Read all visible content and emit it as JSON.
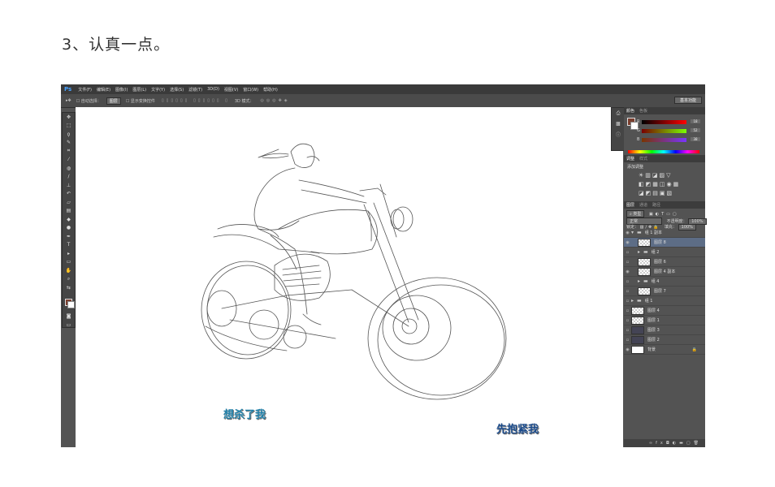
{
  "heading": "3、认真一点。",
  "app": {
    "logo": "Ps",
    "menu": [
      "文件(F)",
      "编辑(E)",
      "图像(I)",
      "图层(L)",
      "文字(Y)",
      "选择(S)",
      "滤镜(T)",
      "3D(D)",
      "视图(V)",
      "窗口(W)",
      "帮助(H)"
    ],
    "options": {
      "auto_select_label": "自动选择：",
      "auto_select_value": "图层",
      "show_transform": "显示变换控件",
      "mode_3d": "3D 模式：",
      "workspace": "基本功能"
    }
  },
  "canvas": {
    "caption1": "想杀了我",
    "caption2": "先抱紧我"
  },
  "panels": {
    "color_tabs": [
      "颜色",
      "色板"
    ],
    "color_sliders": [
      {
        "label": "R",
        "value": "18"
      },
      {
        "label": "G",
        "value": "52"
      },
      {
        "label": "B",
        "value": "38"
      }
    ],
    "adjust_tabs": [
      "调整",
      "样式"
    ],
    "adjust_title": "添加调整",
    "layers_tabs": [
      "图层",
      "通道",
      "路径"
    ],
    "kind_label": "类型",
    "blend_mode": "正常",
    "opacity_label": "不透明度：",
    "opacity_value": "100%",
    "lock_label": "锁定：",
    "fill_label": "填充：",
    "fill_value": "100%",
    "layers": [
      {
        "name": "组 1 副本",
        "type": "group-open",
        "eye": true
      },
      {
        "name": "图层 8",
        "type": "layer",
        "eye": true,
        "selected": true
      },
      {
        "name": "组 2",
        "type": "group",
        "eye": false
      },
      {
        "name": "图层 6",
        "type": "layer",
        "eye": false
      },
      {
        "name": "图层 4 副本",
        "type": "layer",
        "eye": true
      },
      {
        "name": "组 4",
        "type": "group",
        "eye": false
      },
      {
        "name": "图层 7",
        "type": "layer",
        "eye": false
      },
      {
        "name": "组 1",
        "type": "group",
        "eye": false
      },
      {
        "name": "图层 4",
        "type": "layer",
        "eye": false
      },
      {
        "name": "图层 1",
        "type": "layer",
        "eye": false
      },
      {
        "name": "图层 3",
        "type": "layer-dark",
        "eye": false
      },
      {
        "name": "图层 2",
        "type": "layer-dark",
        "eye": false
      },
      {
        "name": "背景",
        "type": "background",
        "eye": true
      }
    ]
  }
}
